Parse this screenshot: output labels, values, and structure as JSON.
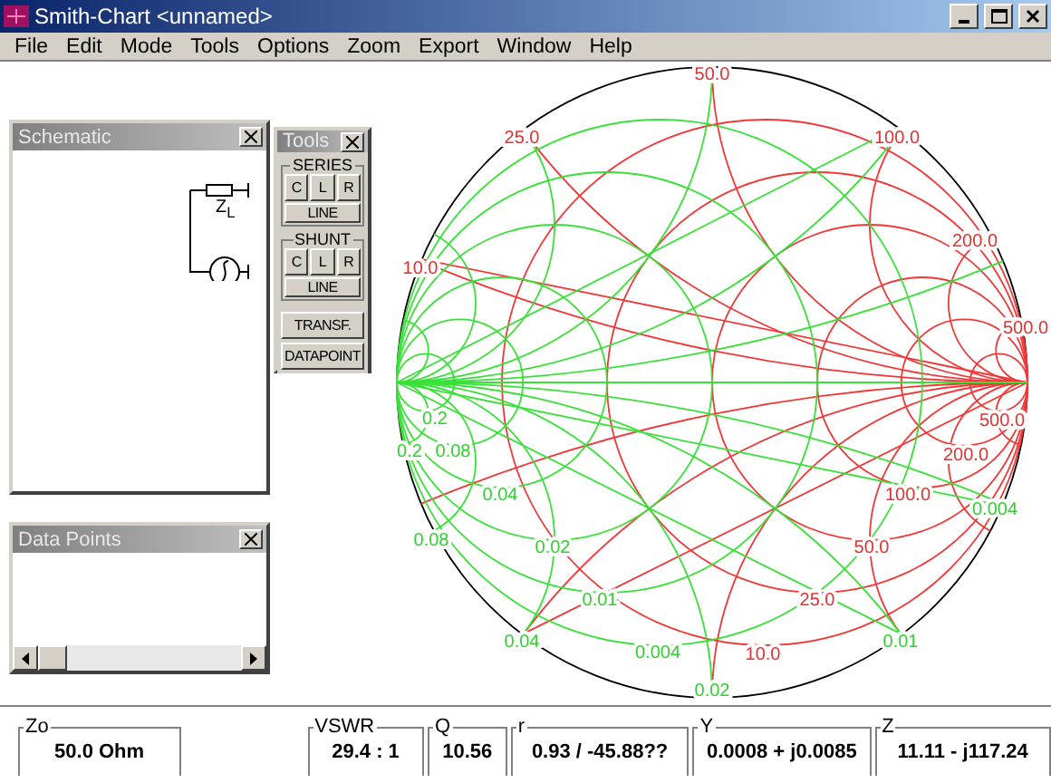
{
  "window": {
    "title": "Smith-Chart <unnamed>"
  },
  "menu": [
    {
      "label": "File"
    },
    {
      "label": "Edit"
    },
    {
      "label": "Mode"
    },
    {
      "label": "Tools"
    },
    {
      "label": "Options"
    },
    {
      "label": "Zoom"
    },
    {
      "label": "Export"
    },
    {
      "label": "Window"
    },
    {
      "label": "Help"
    }
  ],
  "schematic": {
    "title": "Schematic",
    "load_label": "Z$_{L}$"
  },
  "tools": {
    "title": "Tools",
    "groups": [
      {
        "title": "SERIES",
        "buttons": [
          "C",
          "L",
          "R"
        ],
        "line": "LINE"
      },
      {
        "title": "SHUNT",
        "buttons": [
          "C",
          "L",
          "R"
        ],
        "line": "LINE"
      }
    ],
    "actions": [
      "TRANSF.",
      "DATAPOINT"
    ]
  },
  "data_points": {
    "title": "Data Points"
  },
  "chart_labels": [
    {
      "text": "50.0",
      "color": "#e03030"
    },
    {
      "text": "25.0",
      "color": "#e03030"
    },
    {
      "text": "100.0",
      "color": "#e03030"
    },
    {
      "text": "10.0",
      "color": "#e03030"
    },
    {
      "text": "200.0",
      "color": "#e03030"
    },
    {
      "text": "500.0",
      "color": "#e03030"
    },
    {
      "text": "500.0",
      "color": "#e03030"
    },
    {
      "text": "200.0",
      "color": "#e03030"
    },
    {
      "text": "100.0",
      "color": "#e03030"
    },
    {
      "text": "50.0",
      "color": "#e03030"
    },
    {
      "text": "25.0",
      "color": "#e03030"
    },
    {
      "text": "10.0",
      "color": "#e03030"
    },
    {
      "text": "0.2",
      "color": "#30d030"
    },
    {
      "text": "0.2",
      "color": "#30d030"
    },
    {
      "text": "0.08",
      "color": "#30d030"
    },
    {
      "text": "0.04",
      "color": "#30d030"
    },
    {
      "text": "0.08",
      "color": "#30d030"
    },
    {
      "text": "0.02",
      "color": "#30d030"
    },
    {
      "text": "0.01",
      "color": "#30d030"
    },
    {
      "text": "0.04",
      "color": "#30d030"
    },
    {
      "text": "0.004",
      "color": "#30d030"
    },
    {
      "text": "0.01",
      "color": "#30d030"
    },
    {
      "text": "0.004",
      "color": "#30d030"
    },
    {
      "text": "0.02",
      "color": "#30d030"
    }
  ],
  "readouts": [
    {
      "label": "Zo",
      "value": "50.0 Ohm"
    },
    {
      "label": "VSWR",
      "value": "29.4 : 1"
    },
    {
      "label": "Q",
      "value": "10.56"
    },
    {
      "label": "r",
      "value": "0.93 / -45.88??"
    },
    {
      "label": "Y",
      "value": "0.0008 + j0.0085"
    },
    {
      "label": "Z",
      "value": "11.11 - j117.24"
    }
  ]
}
